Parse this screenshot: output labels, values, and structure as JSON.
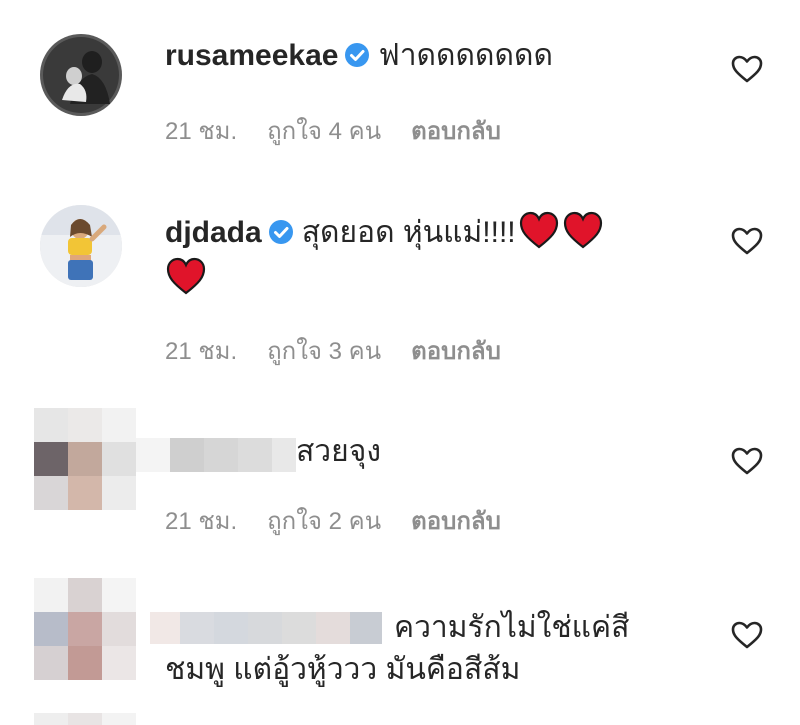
{
  "comments": [
    {
      "username": "rusameekae",
      "verified": true,
      "text": "ฟาดดดดดดด",
      "time": "21 ชม.",
      "likes": "ถูกใจ 4 คน",
      "reply": "ตอบกลับ"
    },
    {
      "username": "djdada",
      "verified": true,
      "text": "สุดยอด หุ่นแม่!!!!",
      "emoji": [
        "red-heart",
        "red-heart",
        "red-heart"
      ],
      "time": "21 ชม.",
      "likes": "ถูกใจ 3 คน",
      "reply": "ตอบกลับ"
    },
    {
      "username_blurred": true,
      "text": "สวยจุง",
      "time": "21 ชม.",
      "likes": "ถูกใจ 2 คน",
      "reply": "ตอบกลับ"
    },
    {
      "username_blurred": true,
      "text_line1": "ความรักไม่ใช่แค่สี",
      "text_line2": "ชมพู แต่อู้วหู้ววว มันคือสีส้ม"
    }
  ],
  "icons": {
    "like": "heart-outline-icon",
    "verified": "verified-badge-icon",
    "emoji": "red-heart-emoji"
  },
  "colors": {
    "verified": "#3897f0",
    "heart": "#e0142a",
    "text": "#262626",
    "meta": "#8e8e8e"
  }
}
